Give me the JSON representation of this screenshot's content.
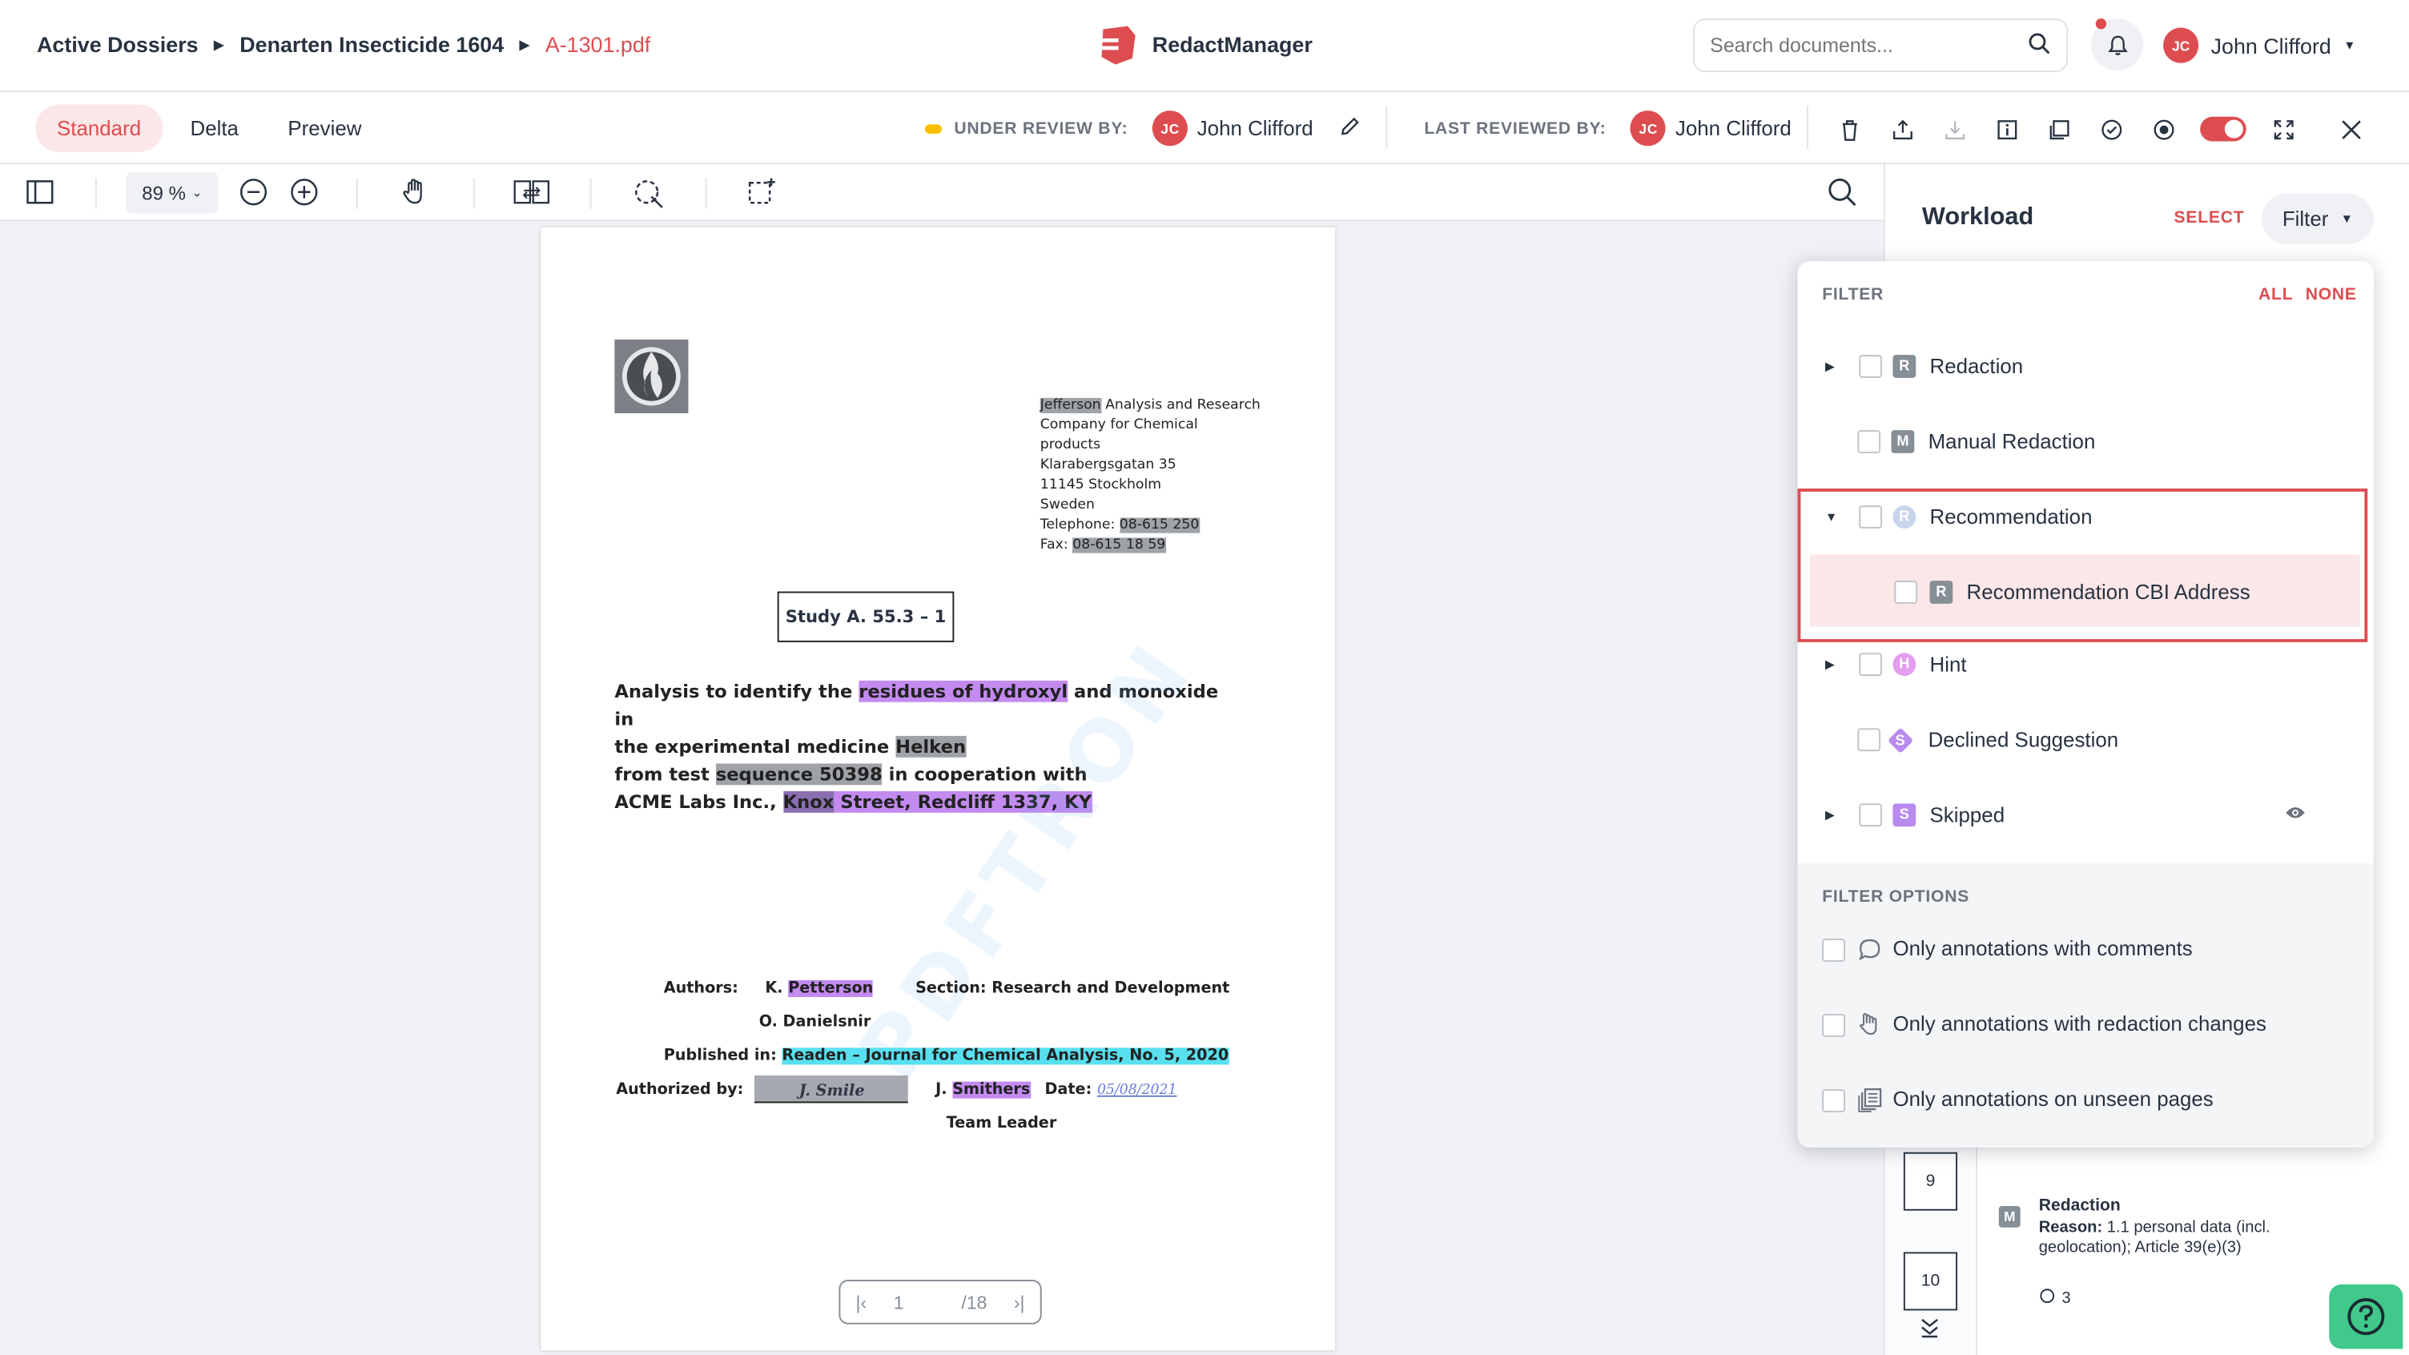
{
  "breadcrumb": {
    "items": [
      "Active Dossiers",
      "Denarten Insecticide 1604"
    ],
    "current": "A-1301.pdf"
  },
  "app": {
    "name": "RedactManager"
  },
  "search": {
    "placeholder": "Search documents..."
  },
  "user": {
    "initials": "JC",
    "name": "John Clifford"
  },
  "tabs": [
    {
      "label": "Standard",
      "active": true
    },
    {
      "label": "Delta",
      "active": false
    },
    {
      "label": "Preview",
      "active": false
    }
  ],
  "review": {
    "under_review_label": "UNDER REVIEW BY:",
    "under_review_name": "John Clifford",
    "last_reviewed_label": "LAST REVIEWED BY:",
    "last_reviewed_name": "John Clifford"
  },
  "viewer": {
    "zoom": "89 %"
  },
  "document": {
    "address": {
      "line1_highlight": "Jefferson",
      "line1_rest": " Analysis and Research",
      "line2": "Company for Chemical",
      "line3": "products",
      "line4": "Klarabergsgatan 35",
      "line5": "11145 Stockholm",
      "line6": "Sweden",
      "tel_label": "Telephone: ",
      "tel_value": "08-615 250",
      "fax_label": "Fax: ",
      "fax_value": "08-615 18 59"
    },
    "study": "Study A. 55.3 – 1",
    "analysis": {
      "p1": "Analysis to identify the ",
      "h1": "residues of hydroxyl",
      "p2": " and monoxide in",
      "p3": "the experimental medicine ",
      "h2": "Helken",
      "p4": "from test ",
      "h3": "sequence 50398",
      "p5": " in cooperation with",
      "p6": "ACME Labs Inc., ",
      "h4": "Knox",
      "h5": " Street, Redcliff 1337, KY"
    },
    "watermark": "PDFTRON",
    "authors_label": "Authors:",
    "author1_prefix": "K. ",
    "author1_highlight": "Petterson",
    "section": "Section: Research and Development",
    "author2": "O. Danielsnir",
    "published_label": "Published in: ",
    "published_value": "Readen – Journal for Chemical Analysis, No. 5, 2020",
    "authorized_label": "Authorized by:",
    "signature": "J. Smile",
    "signer_prefix": "J. ",
    "signer_highlight": "Smithers",
    "date_label": "Date:",
    "date_value": "05/08/2021",
    "role": "Team Leader",
    "pager": {
      "current": "1",
      "total": "/18"
    }
  },
  "workload": {
    "title": "Workload",
    "select": "SELECT",
    "filter": "Filter",
    "thumb_pages": [
      "9",
      "10"
    ],
    "item": {
      "badge": "M",
      "title": "Redaction",
      "reason_label": "Reason:",
      "reason_value": " 1.1 personal data (incl. geolocation); Article 39(e)(3)",
      "comments": "3"
    }
  },
  "filter_dropdown": {
    "header": "FILTER",
    "all": "ALL",
    "none": "NONE",
    "rows": [
      {
        "label": "Redaction",
        "badge": "R",
        "color": "#868e96",
        "caret": true
      },
      {
        "label": "Manual Redaction",
        "badge": "M",
        "color": "#868e96",
        "caret": false
      },
      {
        "label": "Recommendation",
        "badge": "R",
        "color": "#c8d6ec",
        "caret": true,
        "expanded": true
      },
      {
        "label": "Recommendation CBI Address",
        "badge": "R",
        "color": "#868e96",
        "sub": true
      },
      {
        "label": "Hint",
        "badge": "H",
        "color": "#e39cf0",
        "caret": true
      },
      {
        "label": "Declined Suggestion",
        "badge": "S",
        "color": "#b98af0",
        "caret": false
      },
      {
        "label": "Skipped",
        "badge": "S",
        "color": "#b98af0",
        "caret": true
      }
    ],
    "options_header": "FILTER OPTIONS",
    "options": [
      "Only annotations with comments",
      "Only annotations with redaction changes",
      "Only annotations on unseen pages"
    ]
  },
  "colors": {
    "accent": "#dd4d50",
    "help": "#40c98a"
  }
}
